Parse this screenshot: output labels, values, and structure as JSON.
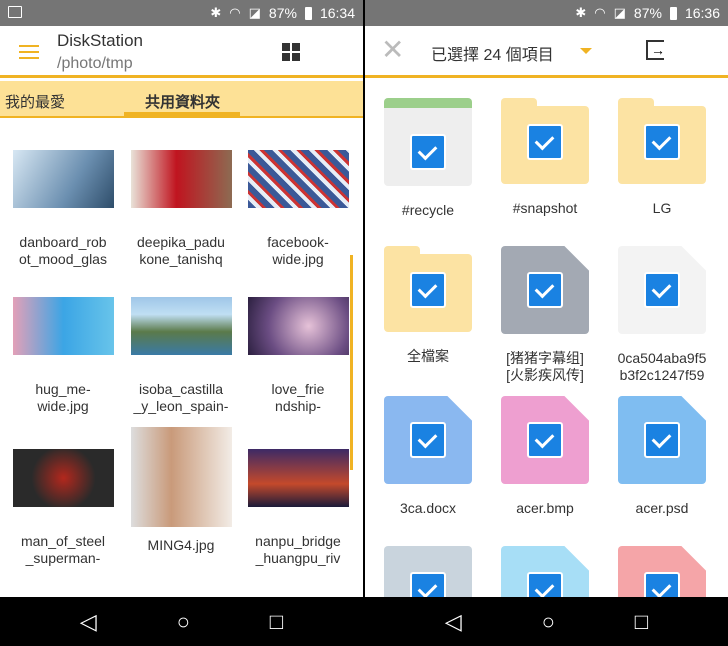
{
  "left": {
    "status": {
      "battery": "87%",
      "time": "16:34"
    },
    "header": {
      "title": "DiskStation",
      "path": "/photo/tmp"
    },
    "tabs": [
      {
        "label": "我的最愛"
      },
      {
        "label": "共用資料夾"
      }
    ],
    "items": [
      {
        "name": "danboard_robot_mood_glas",
        "l1": "danboard_rob",
        "l2": "ot_mood_glas"
      },
      {
        "name": "deepika_padukone_tanishq",
        "l1": "deepika_padu",
        "l2": "kone_tanishq"
      },
      {
        "name": "facebook-wide.jpg",
        "l1": "facebook-",
        "l2": "wide.jpg"
      },
      {
        "name": "hug_me-wide.jpg",
        "l1": "hug_me-",
        "l2": "wide.jpg"
      },
      {
        "name": "isoba_castilla_y_leon_spain-",
        "l1": "isoba_castilla",
        "l2": "_y_leon_spain-"
      },
      {
        "name": "love_friendship-",
        "l1": "love_frie",
        "l2": "ndship-"
      },
      {
        "name": "man_of_steel_superman-",
        "l1": "man_of_steel",
        "l2": "_superman-"
      },
      {
        "name": "MING4.jpg",
        "l1": "MING4.jpg",
        "l2": ""
      },
      {
        "name": "nanpu_bridge_huangpu_riv",
        "l1": "nanpu_bridge",
        "l2": "_huangpu_riv"
      }
    ]
  },
  "right": {
    "status": {
      "battery": "87%",
      "time": "16:36"
    },
    "header": {
      "title": "已選擇 24 個項目"
    },
    "items": [
      {
        "l1": "#recycle",
        "l2": "",
        "type": "recycle"
      },
      {
        "l1": "#snapshot",
        "l2": "",
        "type": "folder"
      },
      {
        "l1": "LG",
        "l2": "",
        "type": "folder"
      },
      {
        "l1": "全檔案",
        "l2": "",
        "type": "folder"
      },
      {
        "l1": "[猪猪字幕组]",
        "l2": "[火影疾风传]",
        "type": "video"
      },
      {
        "l1": "0ca504aba9f5",
        "l2": "b3f2c1247f59",
        "type": "pdf"
      },
      {
        "l1": "3ca.docx",
        "l2": "",
        "type": "docx"
      },
      {
        "l1": "acer.bmp",
        "l2": "",
        "type": "bmp"
      },
      {
        "l1": "acer.psd",
        "l2": "",
        "type": "psd"
      },
      {
        "l1": "",
        "l2": "",
        "type": "web"
      },
      {
        "l1": "",
        "l2": "",
        "type": "globe"
      },
      {
        "l1": "",
        "l2": "",
        "type": "red"
      }
    ]
  },
  "colors": {
    "accent": "#f0b323",
    "tabbar": "#fde196",
    "check": "#1a82e2"
  }
}
